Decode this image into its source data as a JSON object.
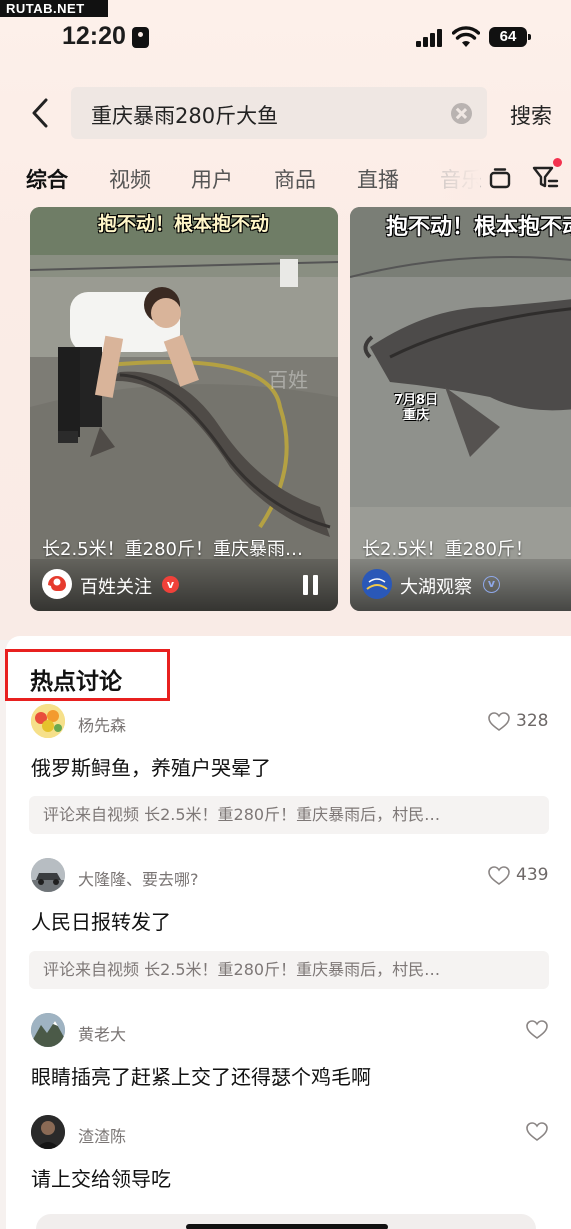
{
  "watermark": "RUTAB.NET",
  "status_bar": {
    "time": "12:20",
    "battery": "64"
  },
  "search": {
    "query": "重庆暴雨280斤大鱼",
    "submit_label": "搜索"
  },
  "tabs": [
    {
      "label": "综合",
      "active": true
    },
    {
      "label": "视频",
      "active": false
    },
    {
      "label": "用户",
      "active": false
    },
    {
      "label": "商品",
      "active": false
    },
    {
      "label": "直播",
      "active": false
    },
    {
      "label": "音乐",
      "active": false
    }
  ],
  "videos": [
    {
      "overlay_text": "抱不动！根本抱不动",
      "title": "长2.5米！重280斤！重庆暴雨…",
      "author": "百姓关注",
      "verified_mark": "v",
      "colors": {
        "avatar": "#e63b2e",
        "verified": "#f0413a"
      }
    },
    {
      "overlay_text": "抱不动！根本抱不动",
      "date_label": "7月8日\n重庆",
      "title": "长2.5米！重280斤！",
      "author": "大湖观察",
      "verified_mark": "v",
      "colors": {
        "avatar": "#2a58b8",
        "verified": "#8fa8e8"
      }
    }
  ],
  "hot_discussion": {
    "title": "热点讨论",
    "comments": [
      {
        "user": "杨先森",
        "likes": "328",
        "text": "俄罗斯鲟鱼，养殖户哭晕了",
        "ref": "评论来自视频 长2.5米！重280斤！重庆暴雨后，村民…"
      },
      {
        "user": "大隆隆、要去哪?",
        "likes": "439",
        "text": "人民日报转发了",
        "ref": "评论来自视频 长2.5米！重280斤！重庆暴雨后，村民…"
      },
      {
        "user": "黄老大",
        "likes": "",
        "text": "眼睛插亮了赶紧上交了还得瑟个鸡毛啊"
      },
      {
        "user": "渣渣陈",
        "likes": "",
        "text": "请上交给领导吃"
      }
    ]
  }
}
